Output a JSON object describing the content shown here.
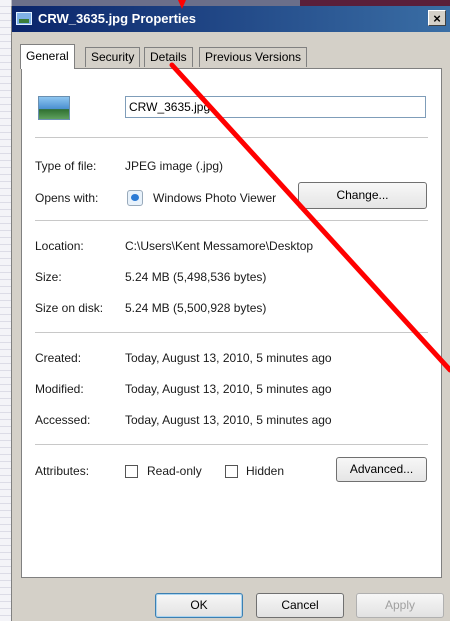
{
  "window": {
    "title": "CRW_3635.jpg Properties",
    "close_glyph": "×"
  },
  "tabs": [
    {
      "label": "General",
      "active": true
    },
    {
      "label": "Security",
      "active": false
    },
    {
      "label": "Details",
      "active": false
    },
    {
      "label": "Previous Versions",
      "active": false
    }
  ],
  "general": {
    "file_name": "CRW_3635.jpg",
    "type_label": "Type of file:",
    "type_value": "JPEG image (.jpg)",
    "opens_label": "Opens with:",
    "opens_value": "Windows Photo Viewer",
    "change_button": "Change...",
    "location_label": "Location:",
    "location_value": "C:\\Users\\Kent Messamore\\Desktop",
    "size_label": "Size:",
    "size_value": "5.24 MB (5,498,536 bytes)",
    "size_on_disk_label": "Size on disk:",
    "size_on_disk_value": "5.24 MB (5,500,928 bytes)",
    "created_label": "Created:",
    "created_value": "Today, August 13, 2010, 5 minutes ago",
    "modified_label": "Modified:",
    "modified_value": "Today, August 13, 2010, 5 minutes ago",
    "accessed_label": "Accessed:",
    "accessed_value": "Today, August 13, 2010, 5 minutes ago",
    "attributes_label": "Attributes:",
    "readonly_label": "Read-only",
    "readonly_checked": false,
    "hidden_label": "Hidden",
    "hidden_checked": false,
    "advanced_button": "Advanced..."
  },
  "footer": {
    "ok": "OK",
    "cancel": "Cancel",
    "apply": "Apply"
  },
  "colors": {
    "annotation_line": "#ff0000",
    "titlebar_start": "#0a246a",
    "titlebar_end": "#3a6ea5"
  }
}
